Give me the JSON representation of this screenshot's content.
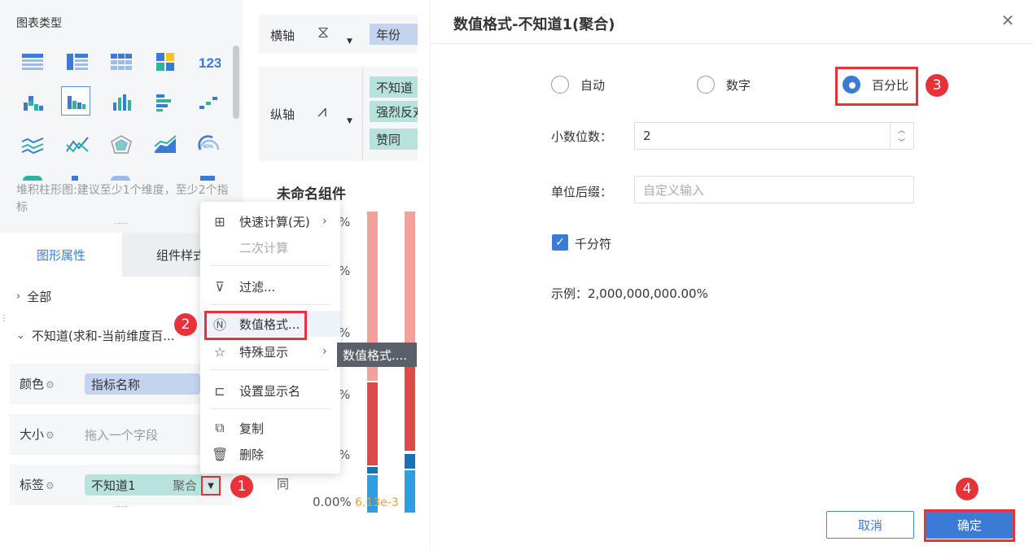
{
  "left_panel": {
    "chart_type_title": "图表类型",
    "chart_icons": [
      "table-icon",
      "crosstab-icon",
      "grouped-table-icon",
      "kpi-grid-icon",
      "number-icon",
      "stacked-bar-icon",
      "bar-chart-icon",
      "column-chart-icon",
      "horizontal-bar-icon",
      "scatter-bars-icon",
      "multi-line-icon",
      "line-chart-icon",
      "radar-chart-icon",
      "area-chart-icon",
      "gauge-icon"
    ],
    "gauge_label": "60%",
    "hint": "堆积柱形图:建议至少1个维度，至少2个指标",
    "tabs": [
      "图形属性",
      "组件样式"
    ],
    "tree": {
      "all": "全部",
      "field": "不知道(求和-当前维度百..."
    },
    "rows": {
      "color": {
        "label": "颜色",
        "pill": "指标名称"
      },
      "size": {
        "label": "大小",
        "placeholder": "拖入一个字段"
      },
      "tag": {
        "label": "标签",
        "pill": "不知道1",
        "pill_suffix": "聚合"
      }
    }
  },
  "axes": {
    "x_label": "横轴",
    "x_pill": "年份",
    "y_label": "纵轴",
    "y_pills": [
      "不知道",
      "强烈反对",
      "赞同"
    ]
  },
  "chart": {
    "title": "未命名组件",
    "y_ticks": [
      "%",
      "%",
      "%",
      "%",
      "%"
    ],
    "bottom_tick": "0.00%",
    "side_char": "同",
    "data_label": "6.13e-3"
  },
  "context_menu": {
    "items": [
      {
        "label": "快速计算(无)",
        "icon": "calculator-icon",
        "submenu": true
      },
      {
        "label": "二次计算",
        "disabled": true
      },
      {
        "label": "过滤...",
        "icon": "filter-icon"
      },
      {
        "label": "数值格式...",
        "icon": "number-format-icon"
      },
      {
        "label": "特殊显示",
        "icon": "star-icon",
        "submenu": true
      },
      {
        "label": "设置显示名",
        "icon": "rename-icon"
      },
      {
        "label": "复制",
        "icon": "copy-icon"
      },
      {
        "label": "删除",
        "icon": "trash-icon"
      }
    ],
    "tooltip": "数值格式...."
  },
  "badges": [
    "1",
    "2",
    "3",
    "4"
  ],
  "dialog": {
    "title": "数值格式-不知道1(聚合)",
    "radios": [
      {
        "label": "自动",
        "checked": false
      },
      {
        "label": "数字",
        "checked": false
      },
      {
        "label": "百分比",
        "checked": true
      }
    ],
    "decimal_label": "小数位数：",
    "decimal_value": "2",
    "suffix_label": "单位后缀：",
    "suffix_placeholder": "自定义输入",
    "thousands_label": "千分符",
    "thousands_checked": true,
    "example": "示例：2,000,000,000.00%",
    "cancel": "取消",
    "ok": "确定"
  },
  "colors": {
    "accent": "#3a7bd5",
    "highlight": "#e63238",
    "bar_pink": "#f4a09c",
    "bar_red": "#dc4a4a",
    "bar_blue": "#2f9ee0"
  }
}
